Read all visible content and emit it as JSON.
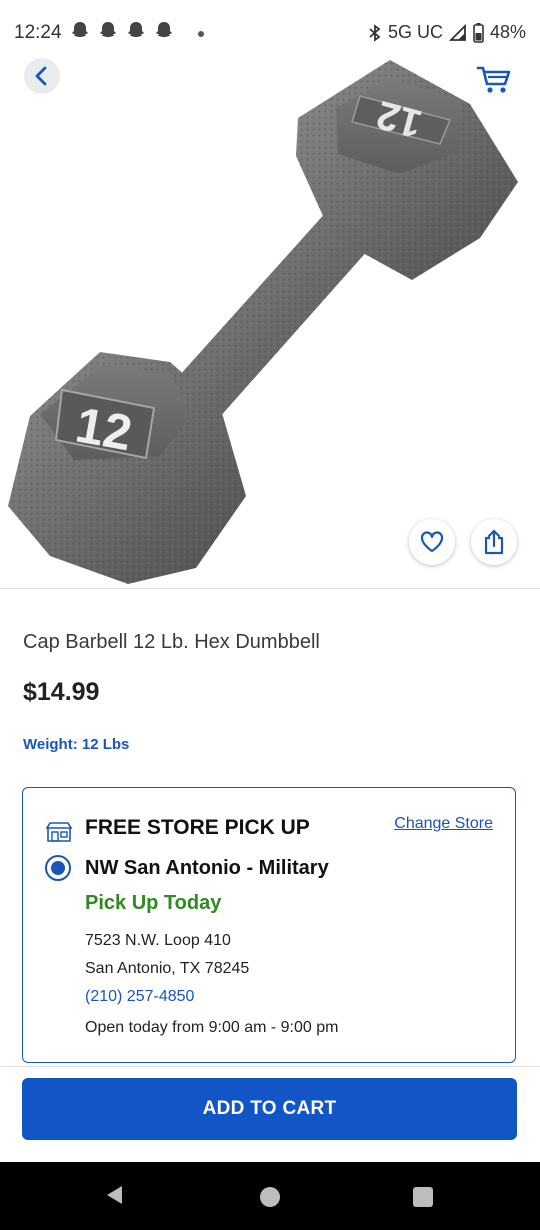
{
  "status_bar": {
    "time": "12:24",
    "network": "5G UC",
    "battery": "48%",
    "icons": [
      "ghost-icon",
      "ghost-icon",
      "ghost-icon",
      "ghost-icon",
      "dot-icon",
      "bluetooth-icon",
      "signal-icon",
      "battery-icon"
    ]
  },
  "header": {
    "back_icon": "chevron-left-icon",
    "cart_icon": "cart-icon"
  },
  "hero": {
    "weight_number": "12",
    "fav_icon": "heart-icon",
    "share_icon": "share-icon"
  },
  "product": {
    "title": "Cap Barbell 12 Lb. Hex Dumbbell",
    "price": "$14.99",
    "weight_label": "Weight: 12 Lbs"
  },
  "pickup": {
    "heading": "FREE STORE PICK UP",
    "change_store": "Change Store",
    "store_name": "NW San Antonio - Military",
    "availability": "Pick Up Today",
    "address_line1": "7523 N.W. Loop 410",
    "address_line2": "San Antonio, TX 78245",
    "phone": "(210) 257-4850",
    "hours": "Open today from 9:00 am - 9:00 pm"
  },
  "cta": {
    "add_to_cart": "ADD TO CART"
  },
  "colors": {
    "accent_blue": "#1155c6",
    "link_blue": "#1a56b8",
    "success_green": "#2e8a21"
  }
}
